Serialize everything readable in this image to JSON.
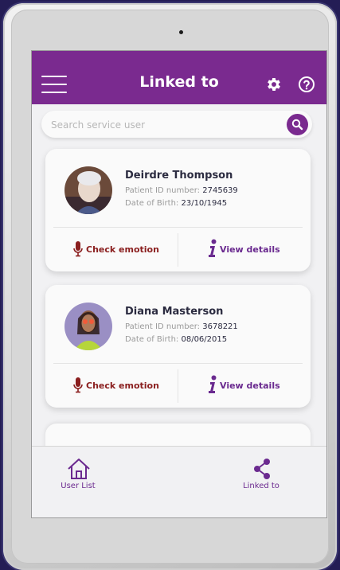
{
  "header": {
    "title": "Linked to"
  },
  "search": {
    "placeholder": "Search service user"
  },
  "patients": [
    {
      "name": "Deirdre Thompson",
      "id_label": "Patient ID number:",
      "id_value": "2745639",
      "dob_label": "Date of Birth:",
      "dob_value": "23/10/1945",
      "check_label": "Check emotion",
      "view_label": "View details"
    },
    {
      "name": "Diana Masterson",
      "id_label": "Patient ID number:",
      "id_value": "3678221",
      "dob_label": "Date of Birth:",
      "dob_value": "08/06/2015",
      "check_label": "Check emotion",
      "view_label": "View details"
    }
  ],
  "nav": {
    "user_list": "User List",
    "linked_to": "Linked to"
  },
  "colors": {
    "brand": "#7a2a8f",
    "emotion": "#8a1e1e"
  },
  "icons": [
    "menu-icon",
    "gear-icon",
    "help-icon",
    "search-icon",
    "microphone-icon",
    "info-icon",
    "home-icon",
    "share-icon"
  ]
}
